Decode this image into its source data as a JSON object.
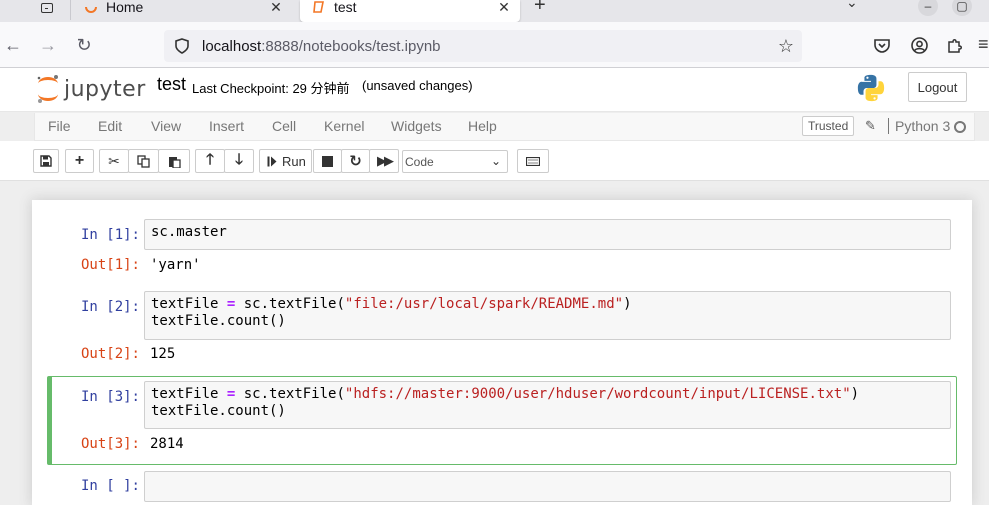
{
  "browser": {
    "tabs": [
      {
        "label": "Home"
      },
      {
        "label": "test"
      }
    ],
    "url": {
      "host": "localhost",
      "rest": ":8888/notebooks/test.ipynb"
    }
  },
  "jupyter": {
    "brand": "jupyter",
    "notebook_title": "test",
    "checkpoint": "Last Checkpoint: 29 分钟前",
    "unsaved": "(unsaved changes)",
    "logout_label": "Logout"
  },
  "menubar": {
    "items": [
      "File",
      "Edit",
      "View",
      "Insert",
      "Cell",
      "Kernel",
      "Widgets",
      "Help"
    ],
    "trusted": "Trusted",
    "kernel": "Python 3"
  },
  "toolbar": {
    "run_label": "Run",
    "cell_type": "Code"
  },
  "cells": [
    {
      "in_prompt": "In [1]:",
      "code_lines": [
        "sc.master"
      ],
      "out_prompt": "Out[1]:",
      "output": "'yarn'"
    },
    {
      "in_prompt": "In [2]:",
      "code_line1": {
        "var": "textFile",
        "op": "=",
        "call": "sc.textFile(",
        "str": "\"file:/usr/local/spark/README.md\"",
        "close": ")"
      },
      "code_line2": "textFile.count()",
      "out_prompt": "Out[2]:",
      "output": "125"
    },
    {
      "in_prompt": "In [3]:",
      "code_line1": {
        "var": "textFile",
        "op": "=",
        "call": "sc.textFile(",
        "str": "\"hdfs://master:9000/user/hduser/wordcount/input/LICENSE.txt\"",
        "close": ")"
      },
      "code_line2": "textFile.count()",
      "out_prompt": "Out[3]:",
      "output": "2814"
    },
    {
      "in_prompt": "In [ ]:",
      "code": ""
    }
  ],
  "colors": {
    "in_prompt": "#303f9f",
    "out_prompt": "#d84315",
    "selected_cell_border": "#66bb6a",
    "string": "#ba2121",
    "operator": "#aa22ff"
  }
}
